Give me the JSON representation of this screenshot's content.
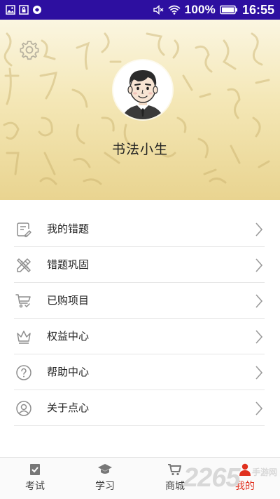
{
  "status_bar": {
    "battery_percent": "100%",
    "time": "16:55"
  },
  "profile": {
    "username": "书法小生"
  },
  "menu": {
    "items": [
      {
        "label": "我的错题",
        "icon": "note-edit-icon"
      },
      {
        "label": "错题巩固",
        "icon": "pencil-ruler-icon"
      },
      {
        "label": "已购项目",
        "icon": "cart-check-icon"
      },
      {
        "label": "权益中心",
        "icon": "crown-icon"
      },
      {
        "label": "帮助中心",
        "icon": "help-circle-icon"
      },
      {
        "label": "关于点心",
        "icon": "user-circle-icon"
      }
    ]
  },
  "bottom_nav": {
    "tabs": [
      {
        "label": "考试",
        "icon": "exam-check-icon"
      },
      {
        "label": "学习",
        "icon": "graduation-cap-icon"
      },
      {
        "label": "商城",
        "icon": "shopping-cart-icon"
      },
      {
        "label": "我的",
        "icon": "person-icon",
        "active": true
      }
    ]
  },
  "watermark": {
    "number": "2265",
    "sub": "手游网"
  },
  "colors": {
    "status_bar_bg": "#2d0fa0",
    "header_gold": "#efdda0",
    "active_tab": "#e0301e",
    "divider": "#e6e6e6"
  }
}
